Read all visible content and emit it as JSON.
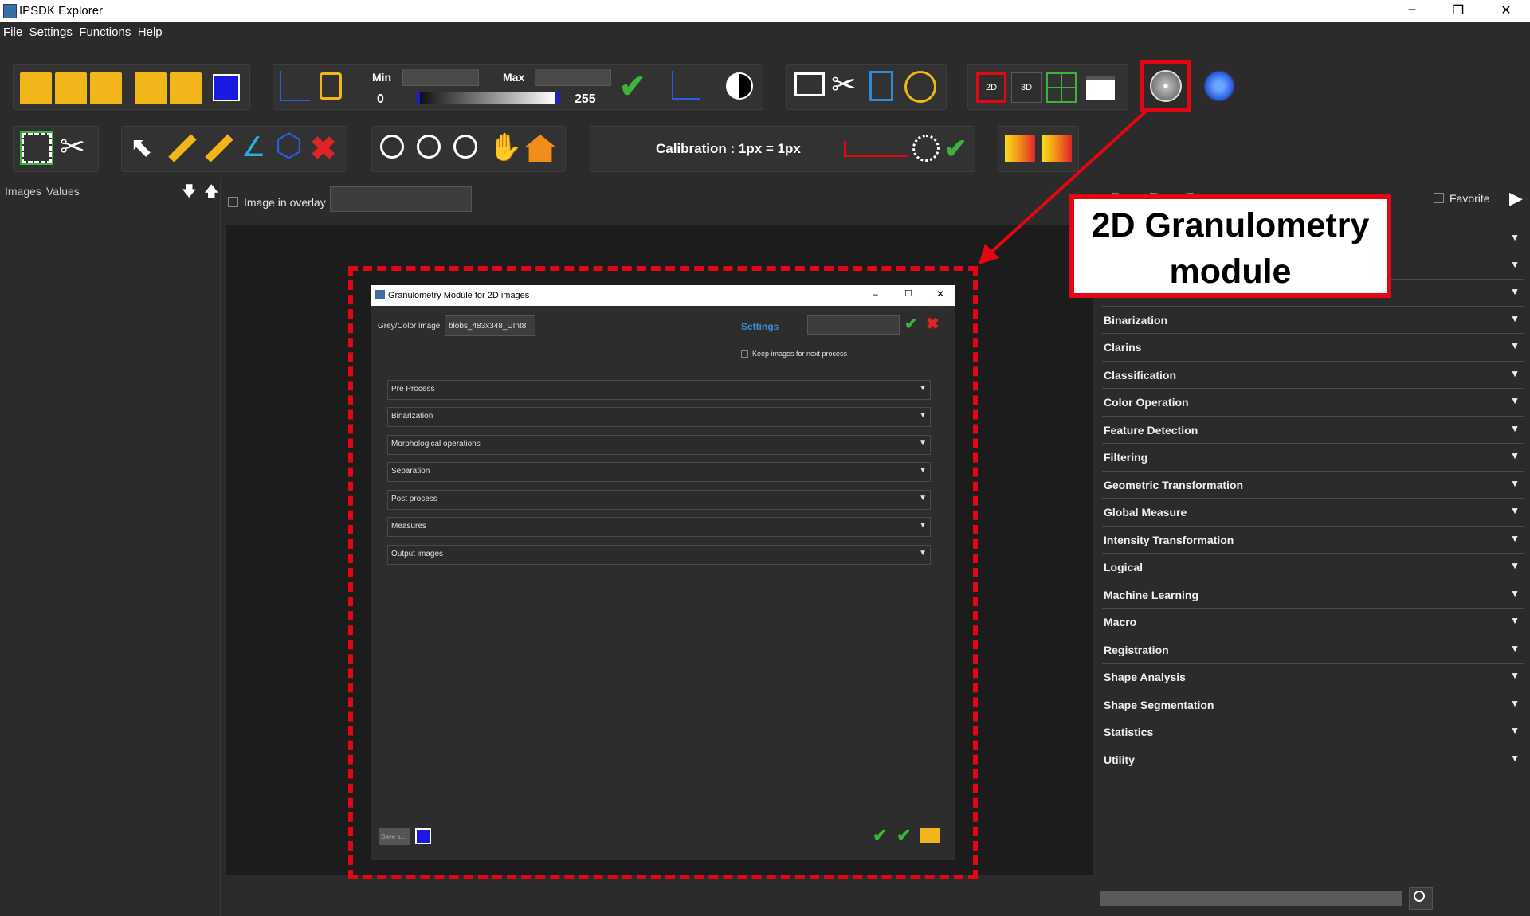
{
  "window": {
    "title": "IPSDK Explorer",
    "controls": [
      "–",
      "❐",
      "✕"
    ]
  },
  "menu": [
    "File",
    "Settings",
    "Functions",
    "Help"
  ],
  "toolbar": {
    "min_label": "Min",
    "max_label": "Max",
    "min_value": "0",
    "max_value": "255",
    "btn_2d": "2D",
    "btn_3d": "3D",
    "calibration": "Calibration : 1px = 1px"
  },
  "left_panel": {
    "tab_images": "Images",
    "tab_values": "Values"
  },
  "center": {
    "overlay_label": "Image in overlay"
  },
  "dialog": {
    "title": "Granulometry Module for 2D images",
    "image_label": "Grey/Color image",
    "image_value": "blobs_483x348_UInt8",
    "settings_label": "Settings",
    "keep_images": "Keep images for next process",
    "sections": [
      "Pre Process",
      "Binarization",
      "Morphological operations",
      "Separation",
      "Post process",
      "Measures",
      "Output images"
    ],
    "save_label": "Save s..."
  },
  "right_panel": {
    "favorite": "Favorite",
    "sections": [
      "Binarization",
      "Clarins",
      "Classification",
      "Color Operation",
      "Feature Detection",
      "Filtering",
      "Geometric Transformation",
      "Global Measure",
      "Intensity Transformation",
      "Logical",
      "Machine Learning",
      "Macro",
      "Registration",
      "Shape Analysis",
      "Shape Segmentation",
      "Statistics",
      "Utility"
    ]
  },
  "annotation": {
    "line1": "2D Granulometry",
    "line2": "module"
  },
  "colors": {
    "accent_red": "#e40613",
    "check_green": "#3cb43c",
    "settings_blue": "#3a8fd8",
    "folder_yellow": "#f2b51a"
  }
}
